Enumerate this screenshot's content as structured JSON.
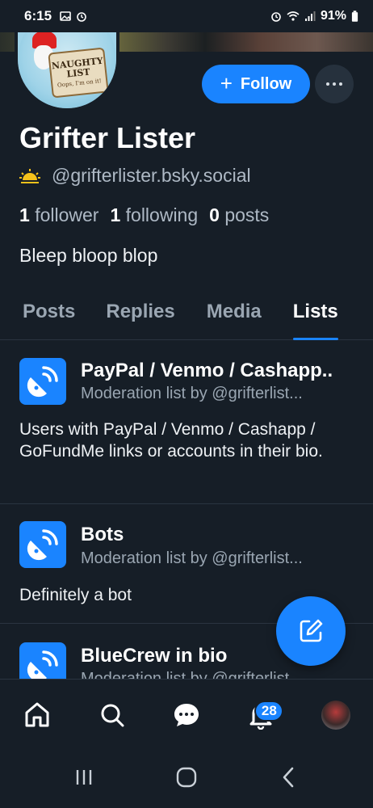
{
  "status_bar": {
    "time": "6:15",
    "battery": "91%"
  },
  "avatar": {
    "title": "NAUGHTY LIST",
    "subtitle": "Oops, I'm on it!"
  },
  "profile": {
    "follow_label": "Follow",
    "name": "Grifter Lister",
    "handle": "@grifterlister.bsky.social",
    "followers_count": "1",
    "followers_label": "follower",
    "following_count": "1",
    "following_label": "following",
    "posts_count": "0",
    "posts_label": "posts",
    "bio": "Bleep bloop blop"
  },
  "tabs": [
    {
      "label": "Posts"
    },
    {
      "label": "Replies"
    },
    {
      "label": "Media"
    },
    {
      "label": "Lists",
      "active": true
    }
  ],
  "lists": [
    {
      "title": "PayPal / Venmo / Cashapp..",
      "subtitle": "Moderation list by @grifterlist...",
      "description": "Users with PayPal / Venmo / Cashapp / GoFundMe links or accounts in their bio."
    },
    {
      "title": "Bots",
      "subtitle": "Moderation list by @grifterlist...",
      "description": "Definitely a bot"
    },
    {
      "title": "BlueCrew in bio",
      "subtitle": "Moderation list by @grifterlist..."
    }
  ],
  "bottom_nav": {
    "notifications_badge": "28"
  },
  "colors": {
    "accent": "#1a84ff",
    "background": "#161e27"
  }
}
